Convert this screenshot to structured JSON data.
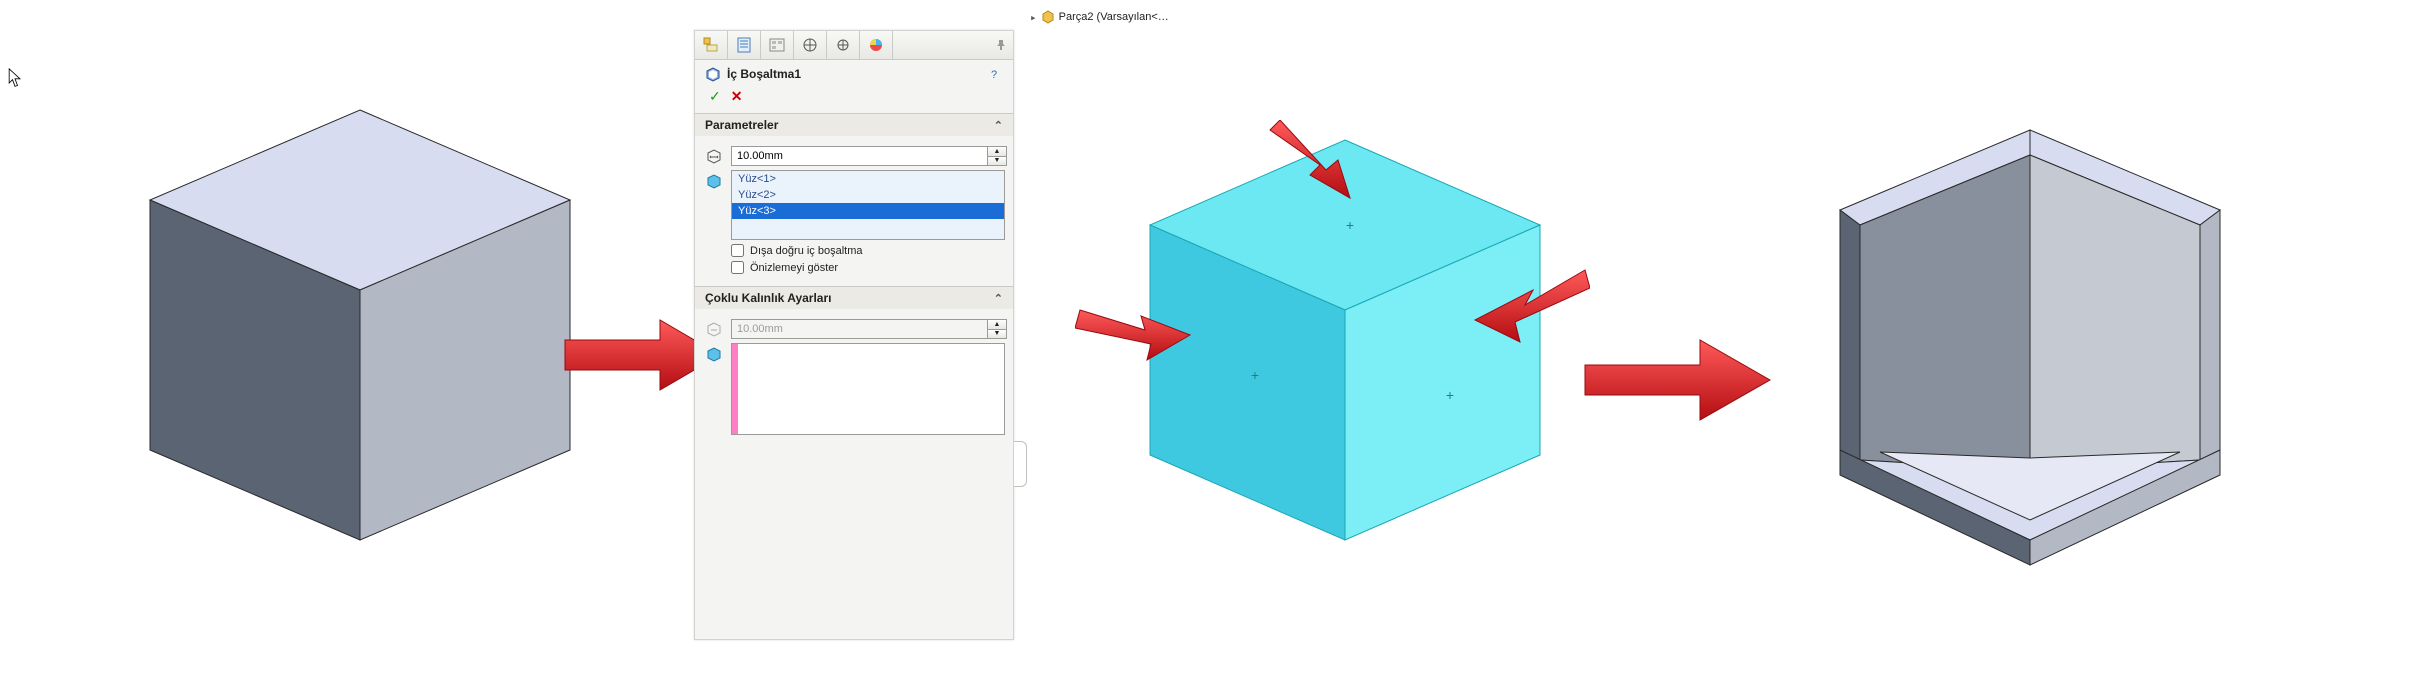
{
  "cursor": {
    "name": "cursor-icon"
  },
  "breadcrumb": {
    "part_label": "Parça2 (Varsayılan<…"
  },
  "panel": {
    "tabs": [
      "feature-tree-icon",
      "properties-icon",
      "config-icon",
      "dimxpert-icon",
      "display-icon",
      "appearances-icon"
    ],
    "title": "İç Boşaltma1",
    "help": "?",
    "confirm": {
      "ok": "✓",
      "cancel": "✕"
    },
    "parametreler": {
      "header": "Parametreler",
      "thickness_value": "10.00mm",
      "faces": [
        "Yüz<1>",
        "Yüz<2>",
        "Yüz<3>"
      ],
      "face_selected_index": 2,
      "checkbox_outward": "Dışa doğru iç boşaltma",
      "checkbox_preview": "Önizlemeyi göster"
    },
    "coklu": {
      "header": "Çoklu Kalınlık Ayarları",
      "thickness_value": "10.00mm"
    }
  },
  "colors": {
    "accent": "#1a6dd6",
    "arrow_fill": "#d8121b",
    "arrow_stroke": "#960a10",
    "cube_solid_top": "#d7dcf0",
    "cube_solid_left": "#5b6472",
    "cube_solid_right": "#b3b8c5",
    "cube_cyan_top": "#6be8f2",
    "cube_cyan_left": "#3fc9e0",
    "cube_cyan_right": "#7ceef5"
  }
}
